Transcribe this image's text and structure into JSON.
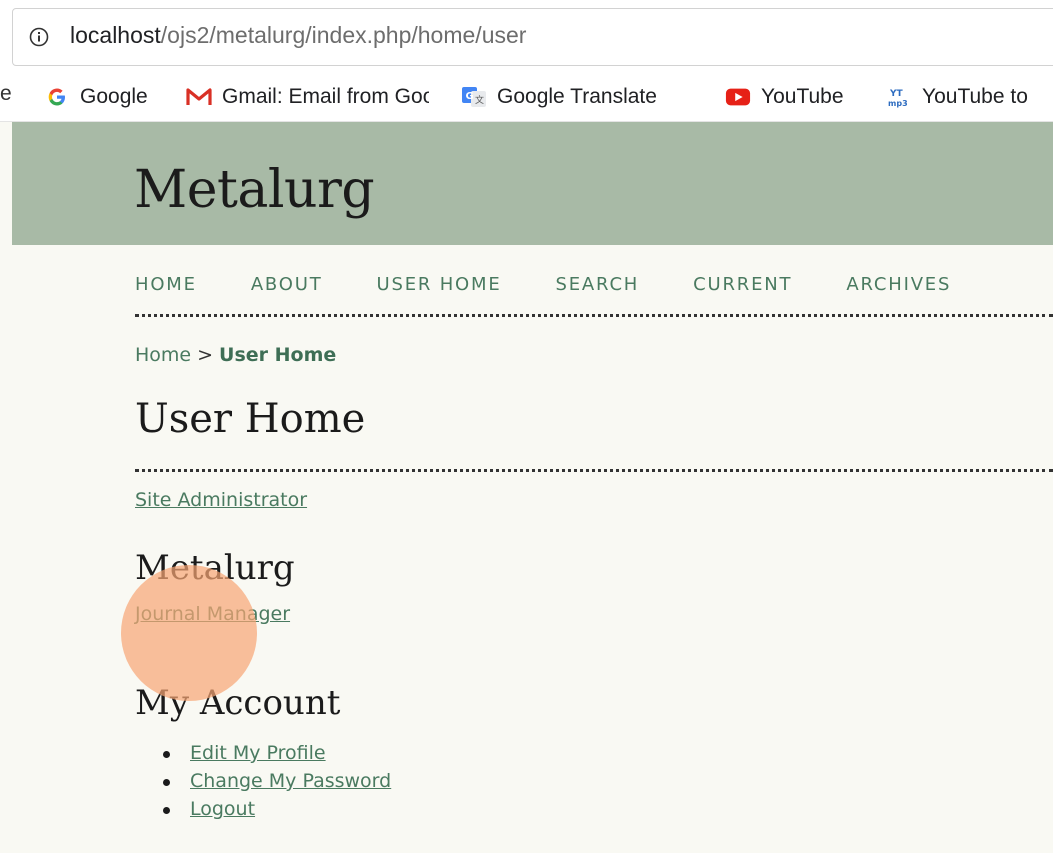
{
  "browser": {
    "url_host": "localhost",
    "url_path": "/ojs2/metalurg/index.php/home/user",
    "bookmarks": [
      {
        "label": "Google",
        "icon": "google-icon"
      },
      {
        "label": "Gmail: Email from Goo",
        "icon": "gmail-icon"
      },
      {
        "label": "Google Translate",
        "icon": "google-translate-icon"
      },
      {
        "label": "YouTube",
        "icon": "youtube-icon"
      },
      {
        "label": "YouTube to",
        "icon": "youtube-mp3-icon"
      }
    ],
    "bookmark_cut": "e"
  },
  "site": {
    "title": "Metalurg"
  },
  "nav": {
    "items": [
      "HOME",
      "ABOUT",
      "USER HOME",
      "SEARCH",
      "CURRENT",
      "ARCHIVES"
    ]
  },
  "breadcrumb": {
    "home": "Home",
    "separator": ">",
    "current": "User Home"
  },
  "page": {
    "title": "User Home",
    "site_admin_link": "Site Administrator",
    "journal_heading": "Metalurg",
    "journal_manager_link": "Journal Manager",
    "account_heading": "My Account",
    "account_links": [
      "Edit My Profile",
      "Change My Password",
      "Logout"
    ]
  },
  "colors": {
    "header_bg": "#a8baa6",
    "page_bg": "#f9f9f3",
    "link": "#4a7a60"
  }
}
